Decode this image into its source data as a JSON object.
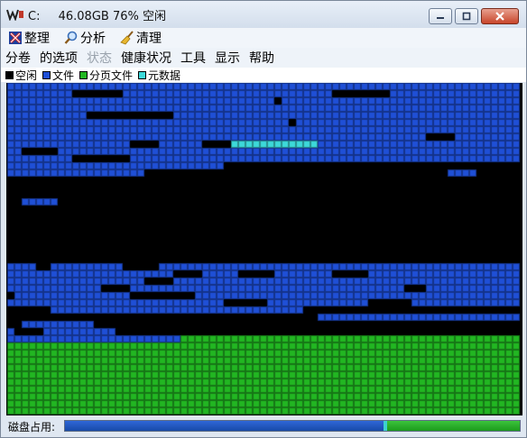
{
  "window": {
    "drive": "C:",
    "summary": "46.08GB 76% 空闲",
    "buttons": [
      "minimize",
      "maximize",
      "close"
    ]
  },
  "toolbar": {
    "items": [
      {
        "label": "整理",
        "icon": "defrag-icon"
      },
      {
        "label": "分析",
        "icon": "magnifier-icon"
      },
      {
        "label": "清理",
        "icon": "broom-icon"
      }
    ]
  },
  "menu": {
    "items": [
      {
        "label": "分卷",
        "disabled": false
      },
      {
        "label": "的选项",
        "disabled": false
      },
      {
        "label": "状态",
        "disabled": true
      },
      {
        "label": "健康状况",
        "disabled": false
      },
      {
        "label": "工具",
        "disabled": false
      },
      {
        "label": "显示",
        "disabled": false
      },
      {
        "label": "帮助",
        "disabled": false
      }
    ]
  },
  "legend": {
    "items": [
      {
        "label": "空闲",
        "color": "#000000"
      },
      {
        "label": "文件",
        "color": "#1f4fd6"
      },
      {
        "label": "分页文件",
        "color": "#22b622"
      },
      {
        "label": "元数据",
        "color": "#3dd9d9"
      }
    ]
  },
  "colors": {
    "free": "#000000",
    "file": "#1f4fd6",
    "pagefile": "#22b622",
    "metadata": "#3dd9d9"
  },
  "status": {
    "label": "磁盘占用:",
    "used_fraction": 0.7,
    "metadata_fraction": 0.008
  }
}
